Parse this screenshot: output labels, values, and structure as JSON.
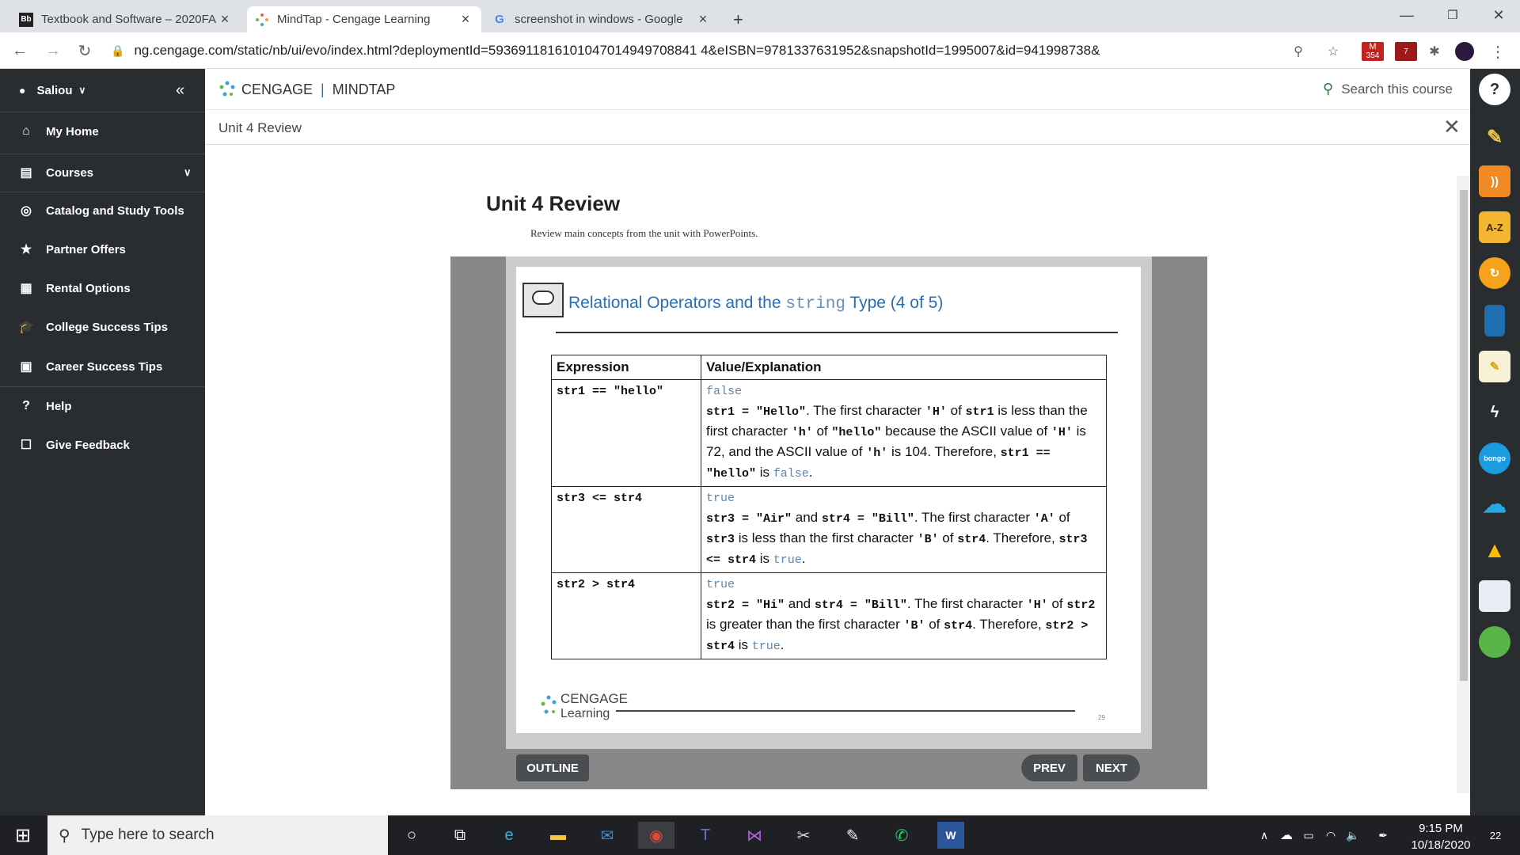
{
  "browser": {
    "tabs": [
      {
        "title": "Textbook and Software – 2020FA",
        "favicon": "Bb"
      },
      {
        "title": "MindTap - Cengage Learning",
        "favicon": "cengage-icon"
      },
      {
        "title": "screenshot in windows - Google",
        "favicon": "G"
      }
    ],
    "url": "ng.cengage.com/static/nb/ui/evo/index.html?deploymentId=5936911816101047014949708841 4&eISBN=9781337631952&snapshotId=1995007&id=941998738&",
    "ext_badge_1": "354",
    "ext_badge_2": "7"
  },
  "sidebar": {
    "user": "Saliou",
    "items": [
      {
        "label": "My Home",
        "icon": "home-icon"
      },
      {
        "label": "Courses",
        "icon": "book-icon"
      },
      {
        "label": "Catalog and Study Tools",
        "icon": "compass-icon"
      },
      {
        "label": "Partner Offers",
        "icon": "star-icon"
      },
      {
        "label": "Rental Options",
        "icon": "book-open-icon"
      },
      {
        "label": "College Success Tips",
        "icon": "graduation-cap-icon"
      },
      {
        "label": "Career Success Tips",
        "icon": "briefcase-icon"
      },
      {
        "label": "Help",
        "icon": "help-icon"
      },
      {
        "label": "Give Feedback",
        "icon": "feedback-icon"
      }
    ]
  },
  "header": {
    "brand": "CENGAGE",
    "product": "MINDTAP",
    "search_label": "Search this course"
  },
  "subheader": {
    "title": "Unit 4 Review"
  },
  "content": {
    "title": "Unit 4 Review",
    "subtitle": "Review main concepts from the unit with PowerPoints."
  },
  "slide": {
    "title_pre": "Relational Operators and the ",
    "title_code": "string",
    "title_post": " Type (4 of 5)",
    "col1": "Expression",
    "col2": "Value/Explanation",
    "rows": [
      {
        "expr": "str1 == \"hello\"",
        "value": "false",
        "e1": "str1 = ",
        "c1": "\"Hello\"",
        "e2": ". The first character ",
        "c2": "'H'",
        "e3": " of ",
        "c3": "str1",
        "e4": " is less than the first character ",
        "c4": "'h'",
        "e5": " of ",
        "c5": "\"hello\"",
        "e6": " because the ASCII value of ",
        "c6": "'H'",
        "e7": " is 72, and the ASCII value of ",
        "c7": "'h'",
        "e8": " is 104. Therefore, ",
        "c8": "str1 == \"hello\"",
        "e9": " is ",
        "v2": "false",
        "e10": "."
      },
      {
        "expr": "str3 <= str4",
        "value": "true",
        "e1": "",
        "c1": "str3 = \"Air\"",
        "e2": " and ",
        "c2": "str4 = \"Bill\"",
        "e3": ". The first character ",
        "c3": "'A'",
        "e4": " of ",
        "c4": "str3",
        "e5": " is less than the first character ",
        "c5": "'B'",
        "e6": " of ",
        "c6": "str4",
        "e7": ". Therefore, ",
        "c7": "str3 <= str4",
        "e8": " is ",
        "v2": "true",
        "e9": "."
      },
      {
        "expr": "str2 > str4",
        "value": "true",
        "e1": "",
        "c1": "str2 = \"Hi\"",
        "e2": " and ",
        "c2": "str4 = \"Bill\"",
        "e3": ". The first character ",
        "c3": "'H'",
        "e4": " of ",
        "c4": "str2",
        "e5": " is greater than the first character ",
        "c5": "'B'",
        "e6": " of ",
        "c6": "str4",
        "e7": ". Therefore, ",
        "c7": "str2 > str4",
        "e8": " is ",
        "v2": "true",
        "e9": "."
      }
    ],
    "footer_brand": "CENGAGE",
    "footer_sub": "Learning",
    "page_no": "29"
  },
  "viewer": {
    "outline": "OUTLINE",
    "prev": "PREV",
    "next": "NEXT"
  },
  "taskbar": {
    "search": "Type here to search",
    "time": "9:15 PM",
    "date": "10/18/2020",
    "notif": "22"
  },
  "colors": {
    "sidebar": "#2a2d30",
    "accent": "#2a6db0",
    "link": "#5b86b3"
  }
}
